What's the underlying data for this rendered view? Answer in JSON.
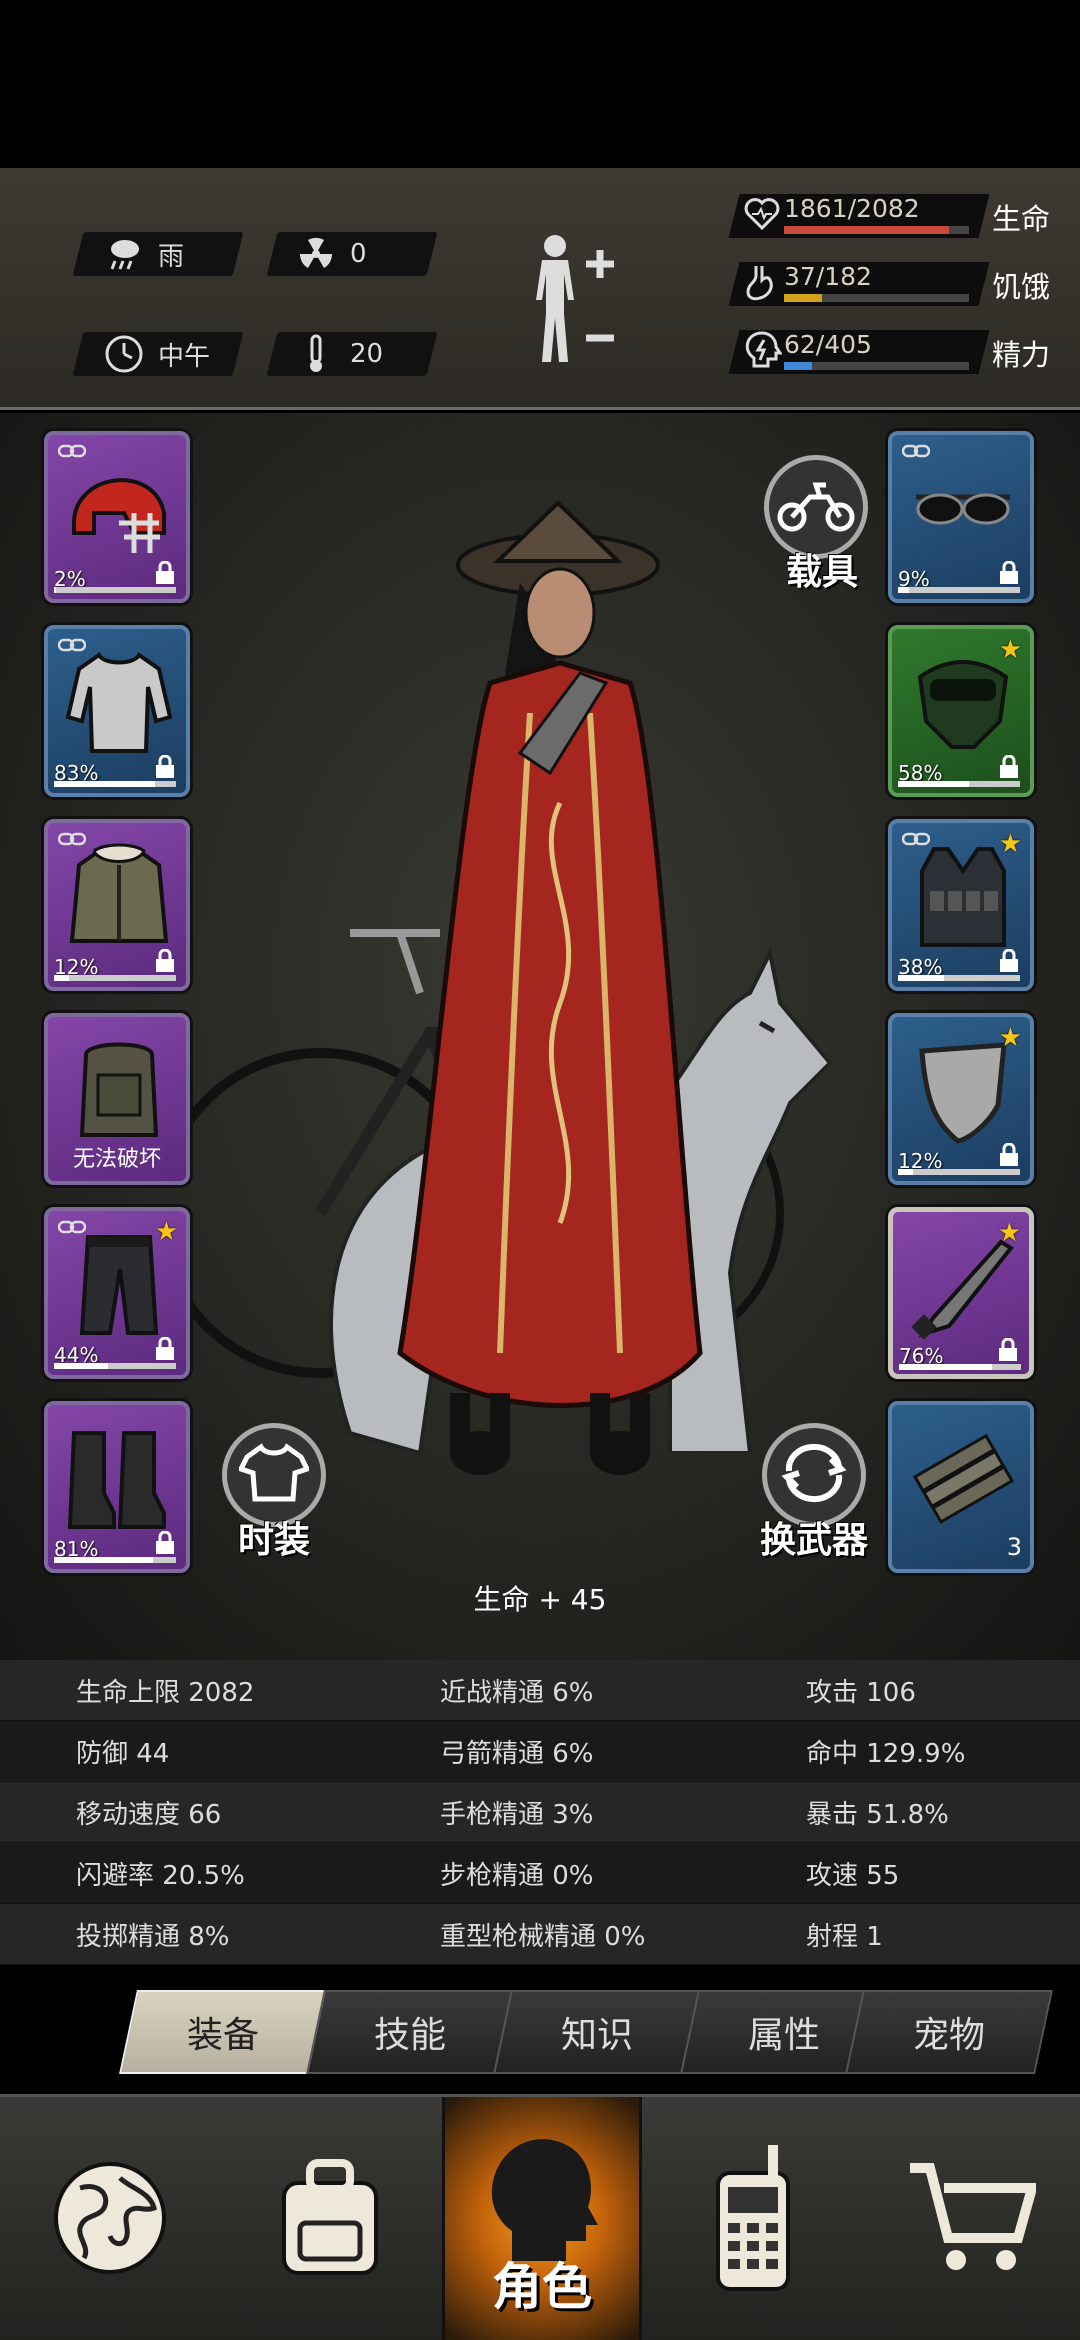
{
  "weather": {
    "condition": "雨",
    "radiation": "0",
    "time_of_day": "中午",
    "temperature": "20"
  },
  "vitals": [
    {
      "value": "1861/2082",
      "name": "生命",
      "fill": 0.894,
      "color": "#c9493a"
    },
    {
      "value": "37/182",
      "name": "饥饿",
      "fill": 0.203,
      "color": "#d4a11c"
    },
    {
      "value": "62/405",
      "name": "精力",
      "fill": 0.153,
      "color": "#3d88d6"
    }
  ],
  "equipment_left": [
    {
      "item": "helmet-icon",
      "durability": "2%",
      "fill": 0.02,
      "rarity": "purple"
    },
    {
      "item": "shirt-icon",
      "durability": "83%",
      "fill": 0.83,
      "rarity": "blue"
    },
    {
      "item": "jacket-icon",
      "durability": "12%",
      "fill": 0.12,
      "rarity": "purple"
    },
    {
      "item": "backpack-icon",
      "caption": "无法破坏",
      "rarity": "purple"
    },
    {
      "item": "pants-icon",
      "durability": "44%",
      "fill": 0.44,
      "rarity": "purple",
      "star": true
    },
    {
      "item": "boots-icon",
      "durability": "81%",
      "fill": 0.81,
      "rarity": "purple"
    }
  ],
  "equipment_right": [
    {
      "item": "sunglasses-icon",
      "durability": "9%",
      "fill": 0.09,
      "rarity": "blue"
    },
    {
      "item": "gas-mask-icon",
      "durability": "58%",
      "fill": 0.58,
      "rarity": "green",
      "star": true
    },
    {
      "item": "vest-icon",
      "durability": "38%",
      "fill": 0.38,
      "rarity": "blue",
      "star": true
    },
    {
      "item": "shield-icon",
      "durability": "12%",
      "fill": 0.12,
      "rarity": "blue",
      "star": true
    },
    {
      "item": "machete-icon",
      "durability": "76%",
      "fill": 0.76,
      "rarity": "purple",
      "star": true,
      "selected": true
    },
    {
      "item": "dynamite-icon",
      "count": "3",
      "rarity": "blue"
    }
  ],
  "buttons": {
    "vehicle": "载具",
    "fashion": "时装",
    "switch_weapon": "换武器"
  },
  "bonus": "生命 + 45",
  "stats": [
    [
      "生命上限 2082",
      "近战精通 6%",
      "攻击 106"
    ],
    [
      "防御 44",
      "弓箭精通 6%",
      "命中 129.9%"
    ],
    [
      "移动速度 66",
      "手枪精通 3%",
      "暴击 51.8%"
    ],
    [
      "闪避率 20.5%",
      "步枪精通 0%",
      "攻速 55"
    ],
    [
      "投掷精通 8%",
      "重型枪械精通 0%",
      "射程 1"
    ]
  ],
  "tabs": [
    "装备",
    "技能",
    "知识",
    "属性",
    "宠物"
  ],
  "active_tab": 0,
  "nav": {
    "active_label": "角色",
    "items": [
      "globe-icon",
      "backpack-icon",
      "character-icon",
      "radio-icon",
      "cart-icon"
    ]
  }
}
